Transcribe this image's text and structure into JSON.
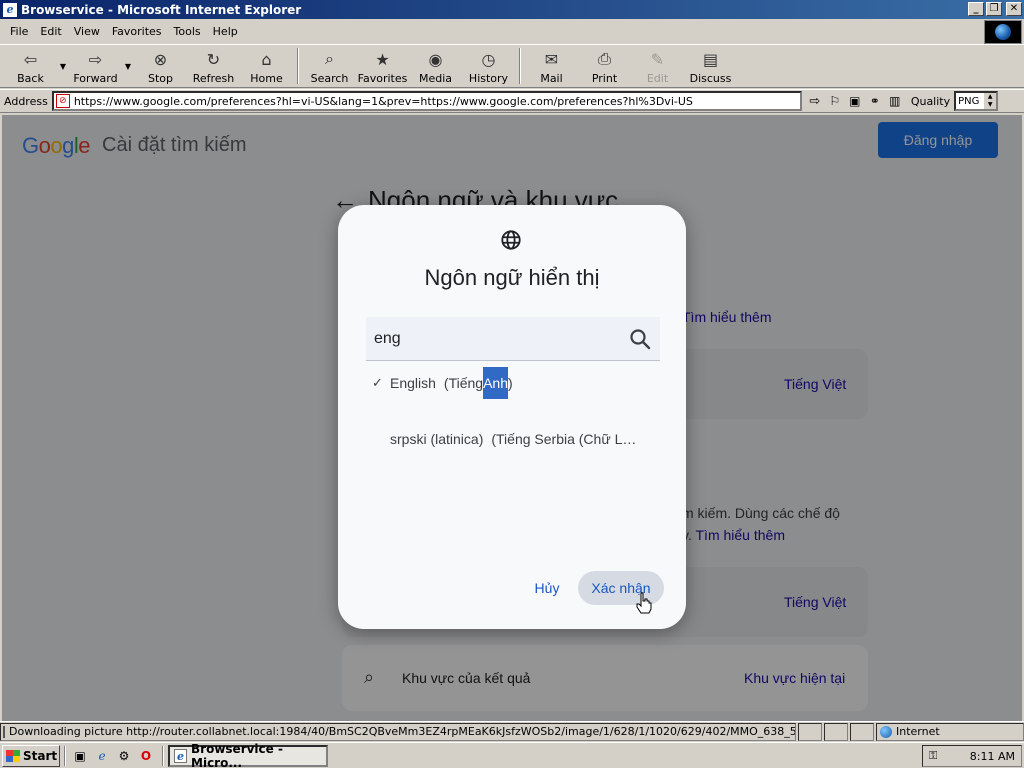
{
  "window": {
    "title": "Browservice - Microsoft Internet Explorer",
    "buttons": [
      "_",
      "❐",
      "✕"
    ]
  },
  "menu": [
    "File",
    "Edit",
    "View",
    "Favorites",
    "Tools",
    "Help"
  ],
  "toolbar": {
    "back": "Back",
    "forward": "Forward",
    "stop": "Stop",
    "refresh": "Refresh",
    "home": "Home",
    "search": "Search",
    "favorites": "Favorites",
    "media": "Media",
    "history": "History",
    "mail": "Mail",
    "print": "Print",
    "edit": "Edit",
    "discuss": "Discuss"
  },
  "address": {
    "label": "Address",
    "url": "https://www.google.com/preferences?hl=vi-US&lang=1&prev=https://www.google.com/preferences?hl%3Dvi-US",
    "quality_label": "Quality",
    "quality_value": "PNG"
  },
  "page": {
    "logo": [
      "G",
      "o",
      "o",
      "g",
      "l",
      "e"
    ],
    "logo_colors": [
      "#4285f4",
      "#ea4335",
      "#fbbc05",
      "#4285f4",
      "#34a853",
      "#ea4335"
    ],
    "title": "Cài đặt tìm kiếm",
    "signin": "Đăng nhập",
    "section_title": "Ngôn ngữ và khu vực",
    "learn_more": "Tìm hiểu thêm",
    "lang_value_1": "Tiếng Việt",
    "desc_text": "m kiếm. Dùng các chế độ",
    "desc_text_2": "y.",
    "learn_more_2": "Tìm hiểu thêm",
    "lang_value_2": "Tiếng Việt",
    "region_label": "Khu vực của kết quả",
    "region_value": "Khu vực hiện tại"
  },
  "modal": {
    "title": "Ngôn ngữ hiển thị",
    "search_value": "eng",
    "options": [
      {
        "check": "✓",
        "name": "English",
        "native_prefix": "(Tiếng ",
        "native_highlight": "Anh",
        "native_suffix": ")"
      },
      {
        "check": "",
        "name": "srpski (latinica)",
        "native": "(Tiếng Serbia (Chữ L…"
      }
    ],
    "cancel": "Hủy",
    "confirm": "Xác nhận"
  },
  "status": {
    "text": "Downloading picture http://router.collabnet.local:1984/40/BmSC2QBveMm3EZ4rpMEaK6kJsfzWOSb2/image/1/628/1/1020/629/402/MMO_638_5",
    "zone": "Internet"
  },
  "taskbar": {
    "start": "Start",
    "task": "Browservice - Micro...",
    "time": "8:11 AM"
  }
}
